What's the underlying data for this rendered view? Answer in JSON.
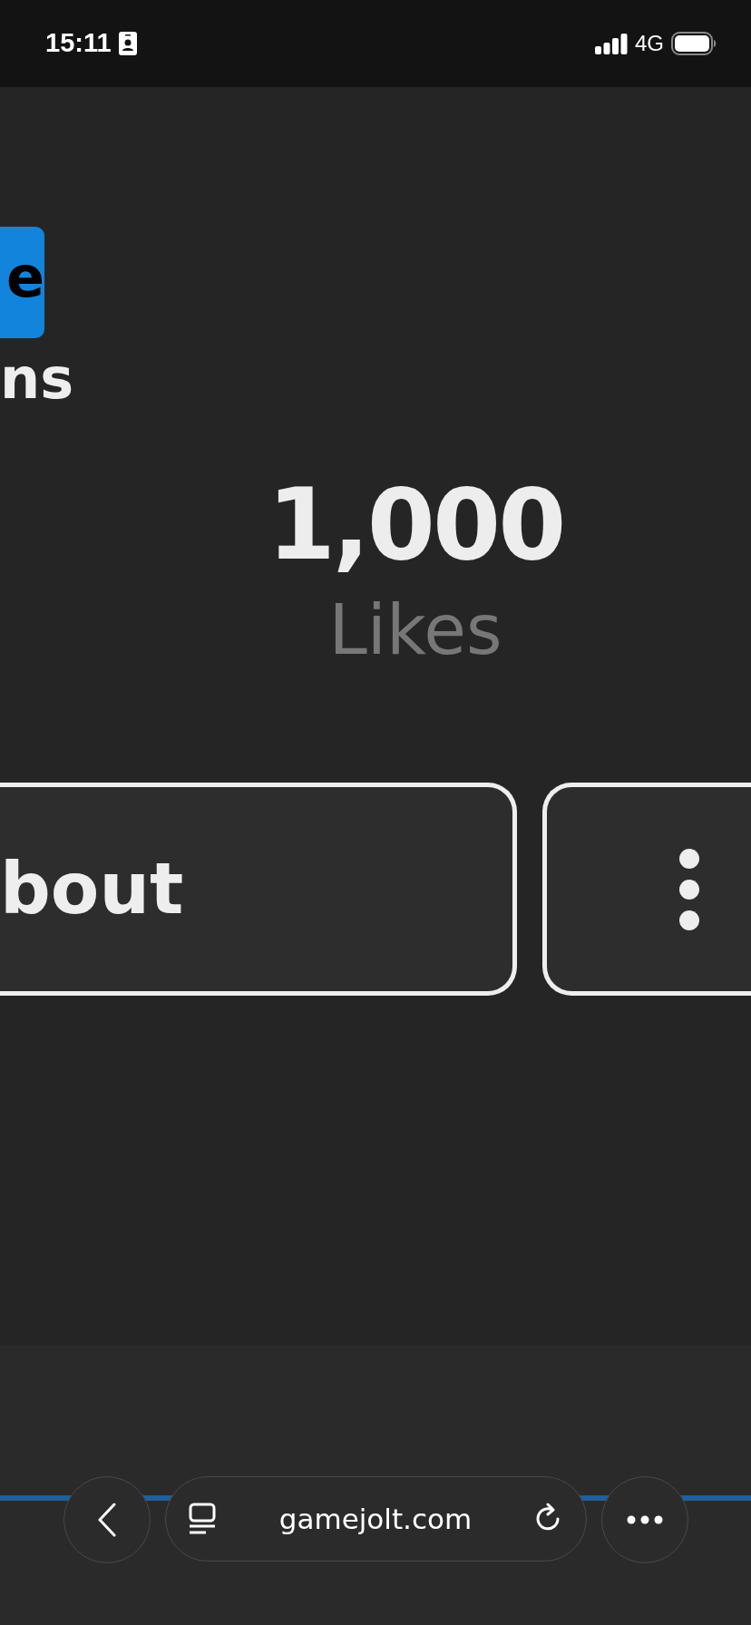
{
  "status_bar": {
    "time": "15:11",
    "network": "4G"
  },
  "page": {
    "top_button": {
      "label": "e"
    },
    "heading": "ns",
    "stat": {
      "value": "1,000",
      "label": "Likes"
    },
    "about_button": {
      "label": "bout"
    }
  },
  "browser": {
    "url": "gamejolt.com",
    "loading_bar": {
      "level": 1
    }
  }
}
